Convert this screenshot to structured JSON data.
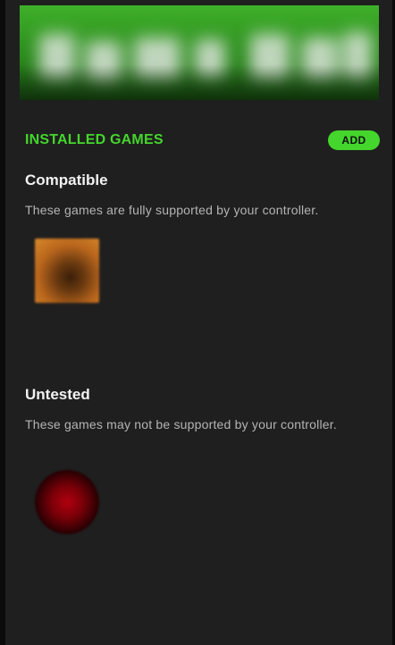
{
  "installed": {
    "title": "INSTALLED GAMES",
    "add_label": "ADD"
  },
  "groups": [
    {
      "title": "Compatible",
      "description": "These games are fully supported by your controller.",
      "games": [
        {
          "name": "",
          "icon": "game-thumbnail-orange"
        }
      ]
    },
    {
      "title": "Untested",
      "description": "These games may not be supported by your controller.",
      "games": [
        {
          "name": "",
          "icon": "game-thumbnail-red-circle"
        }
      ]
    }
  ],
  "colors": {
    "accent": "#44d62c",
    "background": "#1f1f1f",
    "primary_text": "#f2f2f2",
    "secondary_text": "#b4b4b4"
  }
}
